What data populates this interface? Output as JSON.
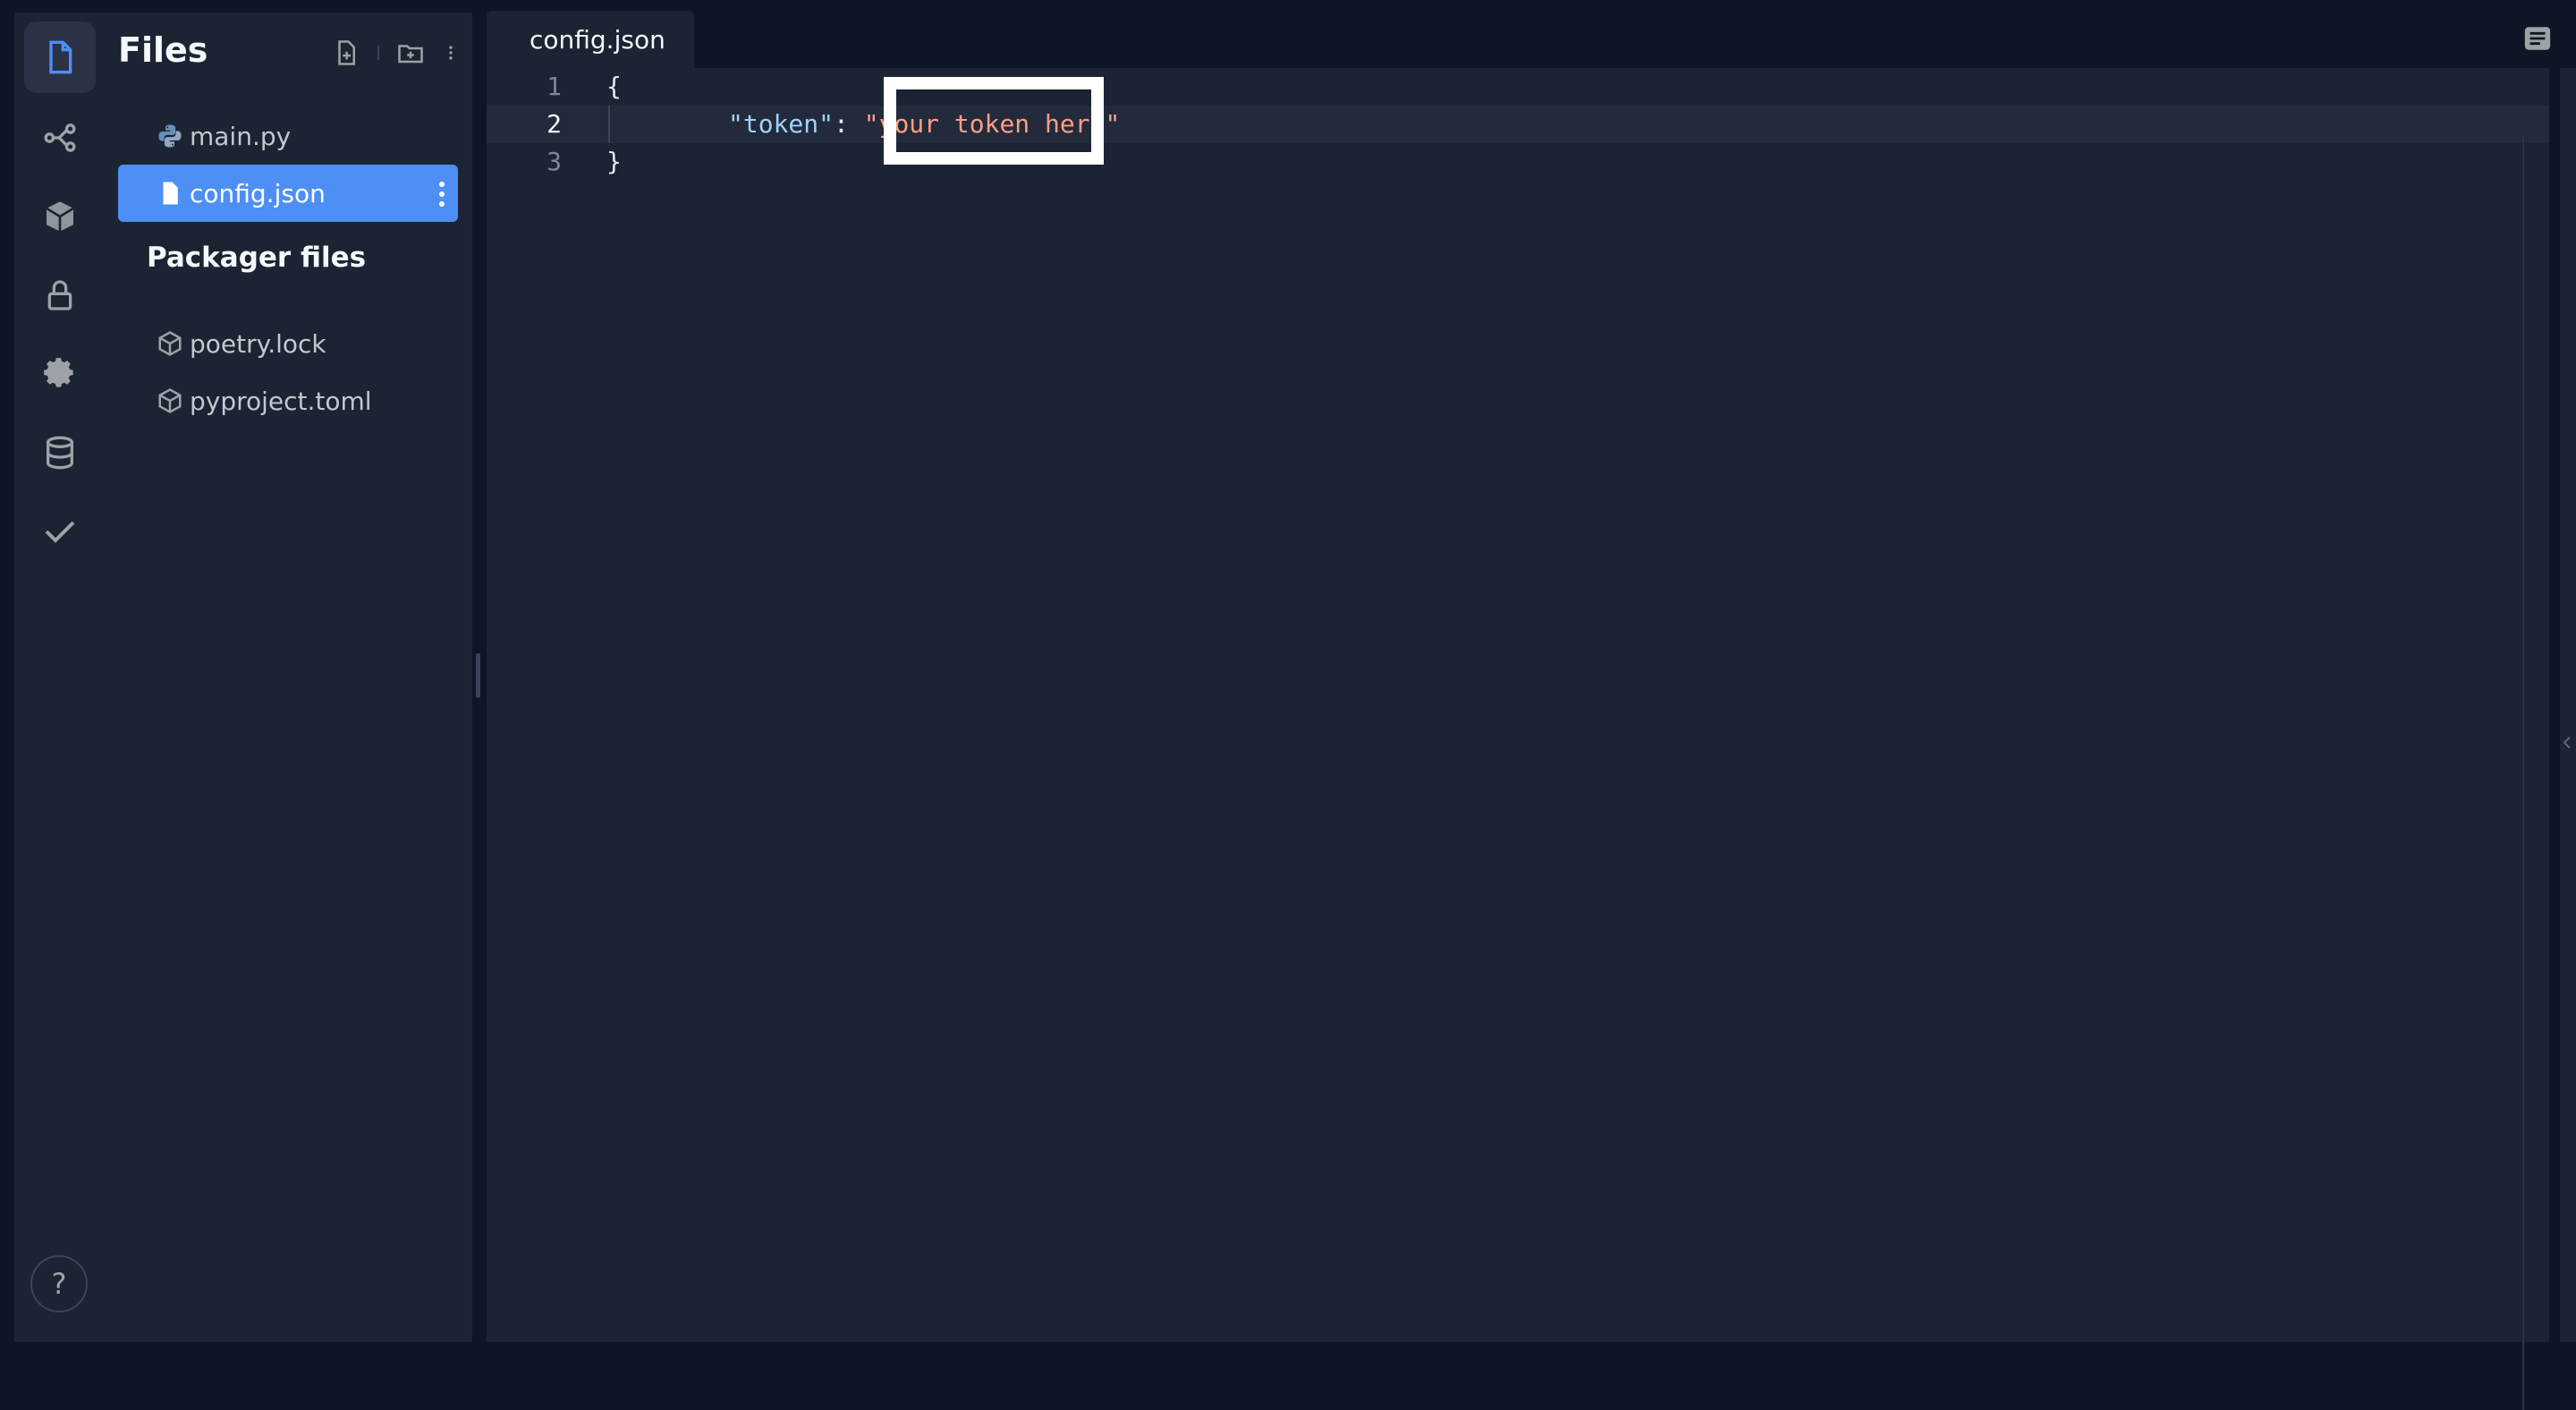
{
  "files_panel": {
    "title": "Files",
    "items": [
      {
        "name": "main.py",
        "icon": "python-icon"
      },
      {
        "name": "config.json",
        "icon": "file-icon",
        "selected": true
      }
    ],
    "packager_section": {
      "title": "Packager files",
      "items": [
        {
          "name": "poetry.lock",
          "icon": "package-icon"
        },
        {
          "name": "pyproject.toml",
          "icon": "package-icon"
        }
      ]
    }
  },
  "rail": {
    "items": [
      "files-icon",
      "git-icon",
      "packages-icon",
      "secrets-lock-icon",
      "settings-gear-icon",
      "database-icon",
      "checkmark-icon"
    ],
    "help_label": "?"
  },
  "editor": {
    "tab_label": "config.json",
    "lines": [
      {
        "number": "1",
        "text": "{"
      },
      {
        "number": "2",
        "key": "\"token\"",
        "sep": ": ",
        "value": "\"your token here\""
      },
      {
        "number": "3",
        "text": "}"
      }
    ],
    "current_line": 2
  },
  "colors": {
    "background": "#0e1525",
    "panel": "#1c2333",
    "accent": "#4e8ff5",
    "json_key": "#9ed1ff",
    "json_string": "#ff9e82"
  }
}
